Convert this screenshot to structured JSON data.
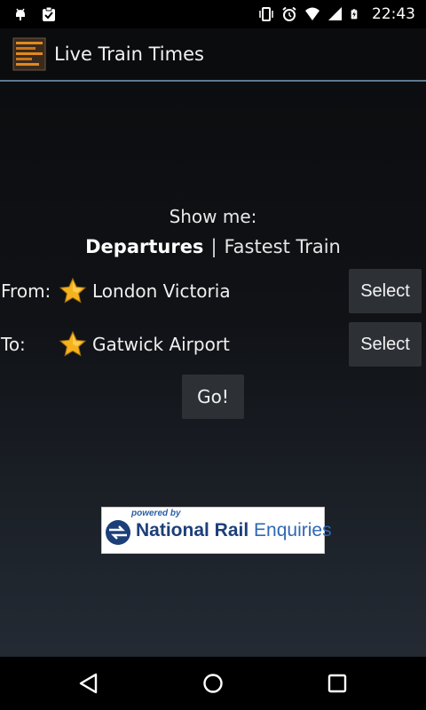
{
  "status_bar": {
    "time": "22:43",
    "left_icons": [
      "android-debug-icon",
      "clipboard-check-icon"
    ],
    "right_icons": [
      "vibrate-icon",
      "alarm-icon",
      "wifi-icon",
      "signal-icon",
      "battery-charging-icon"
    ]
  },
  "action_bar": {
    "title": "Live Train Times",
    "app_icon": "departure-board-icon"
  },
  "main": {
    "show_me_label": "Show me:",
    "mode_active": "Departures",
    "mode_separator": "|",
    "mode_other": "Fastest Train",
    "from": {
      "label": "From:",
      "station": "London Victoria",
      "button_label": "Select"
    },
    "to": {
      "label": "To:",
      "station": "Gatwick Airport",
      "button_label": "Select"
    },
    "go_label": "Go!"
  },
  "logo": {
    "powered_by": "powered by",
    "brand_bold": "National Rail",
    "brand_light": " Enquiries"
  },
  "nav_bar": {
    "icons": [
      "back-icon",
      "home-icon",
      "recent-apps-icon"
    ]
  },
  "colors": {
    "accent_divider": "#5d7a91",
    "button_bg": "#2d3136",
    "star": "#f5b21c",
    "nr_blue": "#1c3f7a"
  }
}
